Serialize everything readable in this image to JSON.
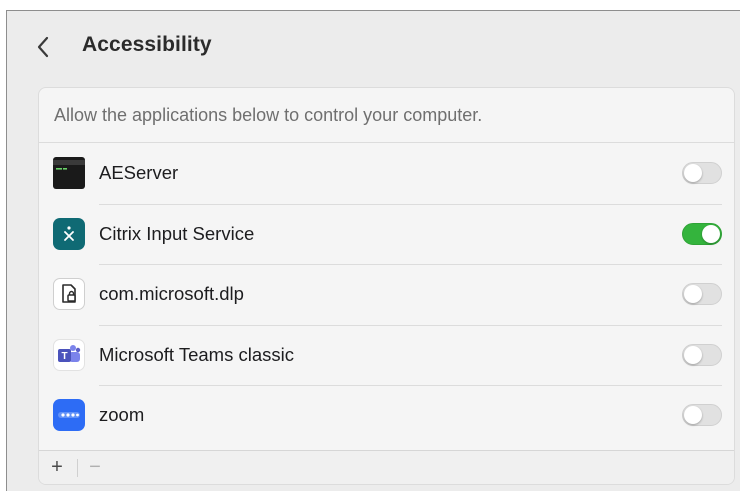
{
  "header": {
    "title": "Accessibility",
    "back_icon": "chevron-left-icon"
  },
  "panel": {
    "description": "Allow the applications below to control your computer.",
    "apps": [
      {
        "name": "AEServer",
        "icon": "terminal-icon",
        "enabled": false
      },
      {
        "name": "Citrix Input Service",
        "icon": "citrix-icon",
        "enabled": true
      },
      {
        "name": "com.microsoft.dlp",
        "icon": "document-lock-icon",
        "enabled": false
      },
      {
        "name": "Microsoft Teams classic",
        "icon": "teams-icon",
        "enabled": false
      },
      {
        "name": "zoom",
        "icon": "zoom-icon",
        "enabled": false
      }
    ]
  },
  "footer": {
    "add_label": "+",
    "remove_label": "−"
  },
  "colors": {
    "toggle_on": "#34b43d",
    "toggle_off": "#e1e1e1",
    "citrix": "#0f6a74",
    "zoom": "#2d6cf5",
    "teams": "#5b5fc7"
  }
}
